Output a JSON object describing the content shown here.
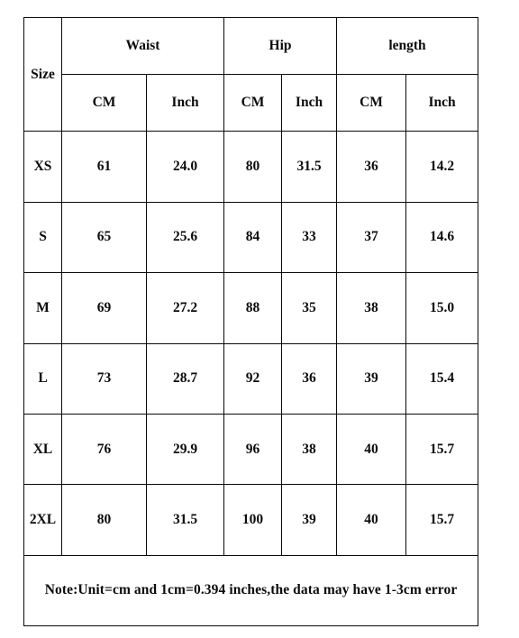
{
  "table": {
    "size_header": "Size",
    "groups": [
      {
        "label": "Waist"
      },
      {
        "label": "Hip"
      },
      {
        "label": "length"
      }
    ],
    "unit_headers": [
      "CM",
      "Inch",
      "CM",
      "Inch",
      "CM",
      "Inch"
    ],
    "rows": [
      {
        "size": "XS",
        "waist_cm": "61",
        "waist_inch": "24.0",
        "hip_cm": "80",
        "hip_inch": "31.5",
        "length_cm": "36",
        "length_inch": "14.2"
      },
      {
        "size": "S",
        "waist_cm": "65",
        "waist_inch": "25.6",
        "hip_cm": "84",
        "hip_inch": "33",
        "length_cm": "37",
        "length_inch": "14.6"
      },
      {
        "size": "M",
        "waist_cm": "69",
        "waist_inch": "27.2",
        "hip_cm": "88",
        "hip_inch": "35",
        "length_cm": "38",
        "length_inch": "15.0"
      },
      {
        "size": "L",
        "waist_cm": "73",
        "waist_inch": "28.7",
        "hip_cm": "92",
        "hip_inch": "36",
        "length_cm": "39",
        "length_inch": "15.4"
      },
      {
        "size": "XL",
        "waist_cm": "76",
        "waist_inch": "29.9",
        "hip_cm": "96",
        "hip_inch": "38",
        "length_cm": "40",
        "length_inch": "15.7"
      },
      {
        "size": "2XL",
        "waist_cm": "80",
        "waist_inch": "31.5",
        "hip_cm": "100",
        "hip_inch": "39",
        "length_cm": "40",
        "length_inch": "15.7"
      }
    ],
    "note": "Note:Unit=cm and 1cm=0.394 inches,the data may have 1-3cm error"
  },
  "colors": {
    "border": "#0a0a0a",
    "text": "#0b0b0b",
    "background": "#ffffff"
  }
}
